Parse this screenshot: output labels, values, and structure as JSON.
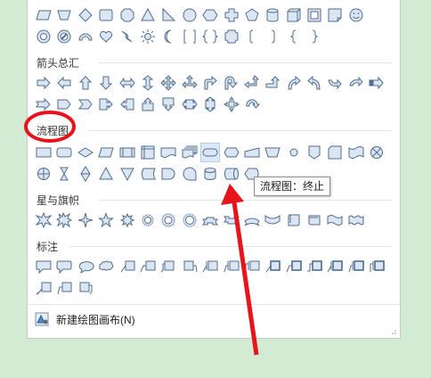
{
  "sections": {
    "flowchart_title": "流程图",
    "arrows_title": "箭头总汇",
    "stars_title": "星与旗帜",
    "callouts_title": "标注"
  },
  "tooltip": "流程图：终止",
  "new_canvas_label": "新建绘图画布(N)",
  "colors": {
    "shape_fill": "#dce6f2",
    "shape_stroke": "#4f6d8e",
    "highlight_bg": "#dde8f6",
    "annotation_red": "#e8141c",
    "background_green": "#d3ebd3"
  },
  "icons": {
    "new_canvas_icon": "drawing-canvas-icon",
    "resize_grip": "resize-grip-icon"
  }
}
